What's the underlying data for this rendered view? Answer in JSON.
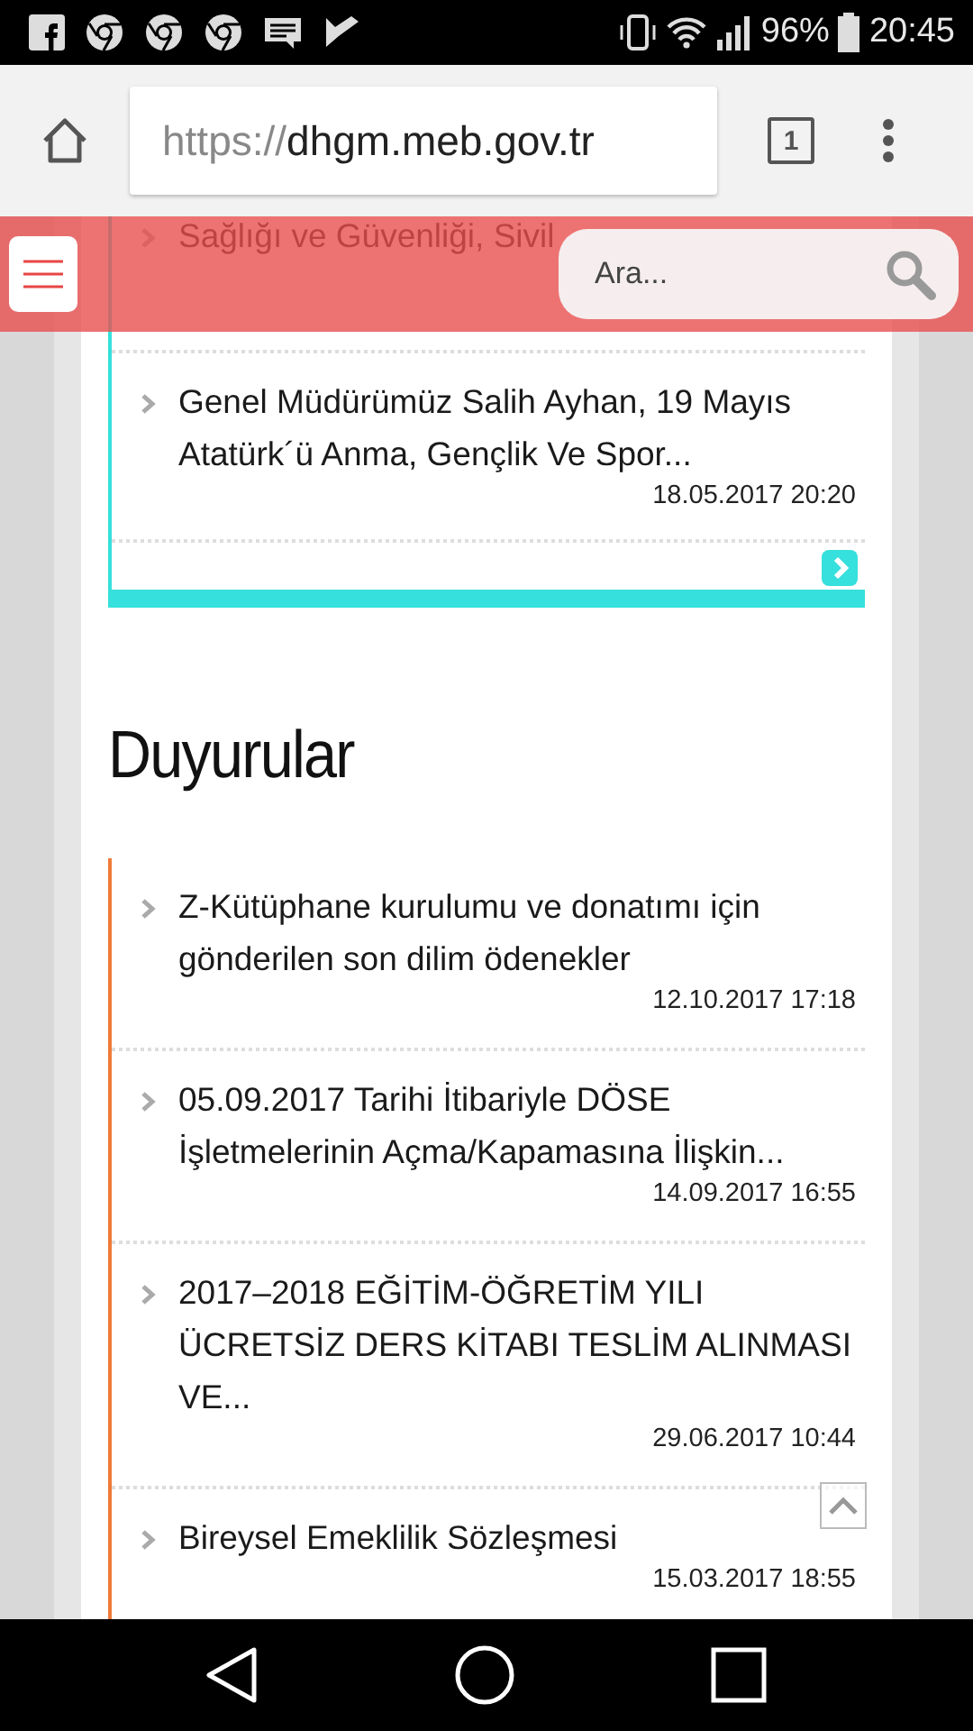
{
  "status_bar": {
    "battery": "96%",
    "time": "20:45"
  },
  "browser": {
    "url_scheme": "https://",
    "url_host": "dhgm.meb.gov.tr",
    "tab_count": "1"
  },
  "header": {
    "search": {
      "placeholder": "Ara..."
    }
  },
  "news": {
    "items": [
      {
        "title": "Sağlığı ve Güvenliği, Sivil"
      },
      {
        "title": "Genel Müdürümüz Salih Ayhan, 19 Mayıs Atatürk´ü Anma, Gençlik Ve Spor...",
        "date": "18.05.2017 20:20"
      }
    ]
  },
  "announcements": {
    "heading": "Duyurular",
    "items": [
      {
        "title": "Z-Kütüphane kurulumu ve donatımı için gönderilen son dilim ödenekler",
        "date": "12.10.2017 17:18"
      },
      {
        "title": "05.09.2017 Tarihi İtibariyle DÖSE İşletmelerinin Açma/Kapamasına İlişkin...",
        "date": "14.09.2017 16:55"
      },
      {
        "title": "2017–2018 EĞİTİM-ÖĞRETİM YILI ÜCRETSİZ DERS KİTABI TESLİM ALINMASI VE...",
        "date": "29.06.2017 10:44"
      },
      {
        "title": "Bireysel Emeklilik Sözleşmesi",
        "date": "15.03.2017 18:55"
      }
    ]
  }
}
